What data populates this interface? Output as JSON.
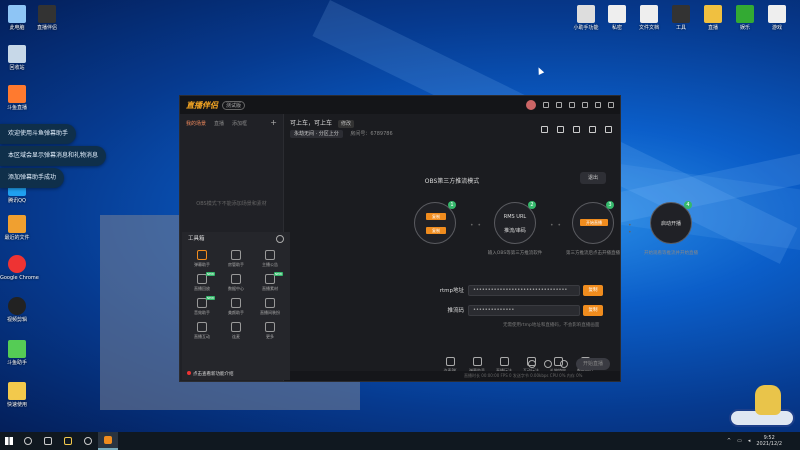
{
  "desktop_icons_left": [
    {
      "label": "此电脑"
    },
    {
      "label": "直播伴侣"
    },
    {
      "label": "回收站"
    },
    {
      "label": "斗鱼直播"
    },
    {
      "label": "腾讯QQ"
    },
    {
      "label": "最近的文件"
    },
    {
      "label": "Google Chrome"
    },
    {
      "label": "视频剪辑"
    },
    {
      "label": "斗鱼助手"
    },
    {
      "label": "快速使用"
    }
  ],
  "desktop_icons_right": [
    {
      "label": "小助手功能"
    },
    {
      "label": "私密"
    },
    {
      "label": "文件文档"
    },
    {
      "label": "工具"
    },
    {
      "label": "直播"
    },
    {
      "label": "娱乐"
    },
    {
      "label": "游戏"
    }
  ],
  "toasts": [
    "欢迎使用斗鱼弹幕助手",
    "本区域会显示弹幕消息和礼物消息",
    "添加弹幕助手成功"
  ],
  "app": {
    "logo": "直播伴侣",
    "version_tag": "测试版",
    "left_tabs": [
      "我的场景",
      "直播",
      "添加框"
    ],
    "left_plus": "+",
    "left_empty": "OBS模式下不能添加场景和素材",
    "room_title": "可上车，可上车",
    "room_edit": "修改",
    "room_category": "永劫无间 · 分区上分",
    "room_meta": "房间号：6789786",
    "mode_title": "OBS第三方推流模式",
    "exit_label": "退出",
    "steps": [
      {
        "num": "1",
        "btn1": "复制",
        "btn2": "复制",
        "text": ""
      },
      {
        "num": "2",
        "text1": "RMS URL",
        "text2": "推流/串码"
      },
      {
        "num": "3",
        "btn": "开始直播"
      },
      {
        "num": "4",
        "text1": "启动开播"
      }
    ],
    "step_captions": [
      "",
      "输入OBS等第三方推流软件",
      "第三方推流后点击开播直播",
      "开始观看等推流并开始直播"
    ],
    "rtmp_label": "rtmp地址",
    "rtmp_value": "••••••••••••••••••••••••••••••••",
    "push_label": "推流码",
    "push_value": "••••••••••••••",
    "copy_label": "复制",
    "hint": "无需使用rtmp地址和直播码，不会影响直播画面",
    "toolbar": [
      "连麦PK",
      "弹幕助手",
      "直播玩法",
      "互动玩法",
      "礼物特效",
      "数据中心",
      "房间管理",
      "背包",
      "高级设置"
    ],
    "start_label": "开始直播",
    "status_text": "直播时长 00:00:00    FPS 0    发送字节 0.00kbps    CPU 0%    内存 0%"
  },
  "popup": {
    "title": "工具箱",
    "items": [
      {
        "label": "弹幕助手",
        "badge": ""
      },
      {
        "label": "房管助手",
        "badge": ""
      },
      {
        "label": "主播公告",
        "badge": ""
      },
      {
        "label": "直播回放",
        "badge": "NEW"
      },
      {
        "label": "数据中心",
        "badge": ""
      },
      {
        "label": "直播素材",
        "badge": "NEW"
      },
      {
        "label": "音效助手",
        "badge": "NEW"
      },
      {
        "label": "美颜助手",
        "badge": ""
      },
      {
        "label": "直播间装扮",
        "badge": ""
      },
      {
        "label": "直播互动",
        "badge": ""
      },
      {
        "label": "连麦",
        "badge": ""
      },
      {
        "label": "更多",
        "badge": ""
      }
    ],
    "footer": "点击查看新功能介绍"
  },
  "taskbar": {
    "time": "9:52",
    "date": "2021/12/2"
  }
}
